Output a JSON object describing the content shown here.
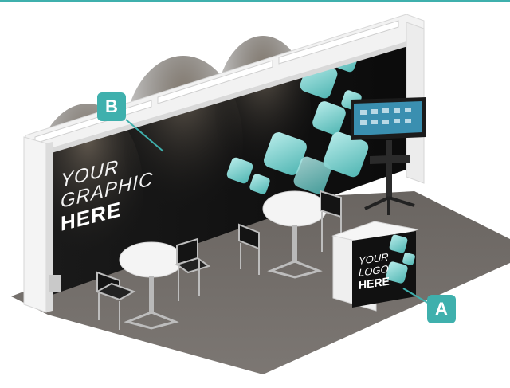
{
  "accent_color": "#3fb0ad",
  "backwall_graphic": {
    "line1": "YOUR",
    "line2": "GRAPHIC",
    "line3": "HERE"
  },
  "counter_graphic": {
    "line1": "YOUR",
    "line2": "LOGO",
    "line3": "HERE"
  },
  "callouts": {
    "a": "A",
    "b": "B"
  }
}
